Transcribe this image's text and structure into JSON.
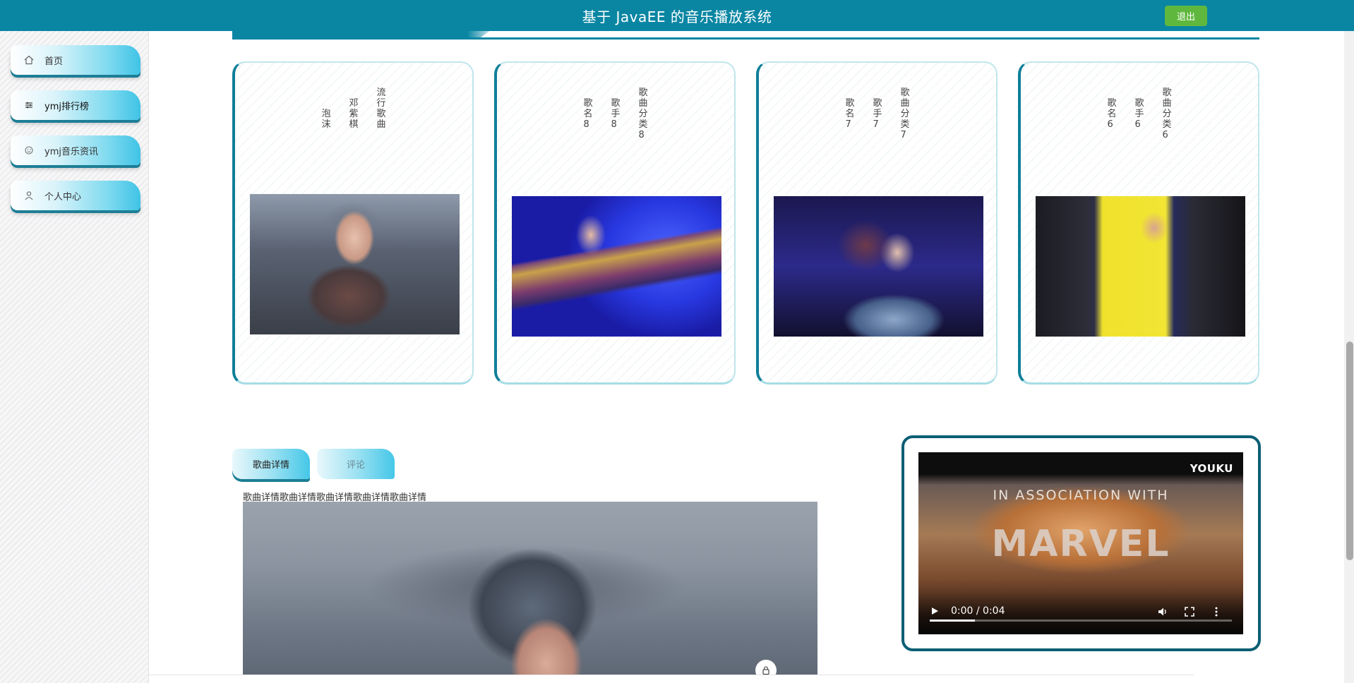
{
  "header": {
    "title": "基于 JavaEE 的音乐播放系统",
    "logout_label": "退出",
    "color": "#0a86a3"
  },
  "sidebar": {
    "items": [
      {
        "label": "首页",
        "icon": "home-icon"
      },
      {
        "label": "ymj排行榜",
        "icon": "sliders-icon"
      },
      {
        "label": "ymj音乐资讯",
        "icon": "news-icon"
      },
      {
        "label": "个人中心",
        "icon": "user-icon"
      }
    ]
  },
  "songs": [
    {
      "name": "泡沫",
      "singer": "邓紫棋",
      "category": "流行歌曲"
    },
    {
      "name": "歌名8",
      "singer": "歌手8",
      "category": "歌曲分类8"
    },
    {
      "name": "歌名7",
      "singer": "歌手7",
      "category": "歌曲分类7"
    },
    {
      "name": "歌名6",
      "singer": "歌手6",
      "category": "歌曲分类6"
    }
  ],
  "tabs": {
    "detail": "歌曲详情",
    "comment": "评论"
  },
  "detail_text": "歌曲详情歌曲详情歌曲详情歌曲详情歌曲详情",
  "video": {
    "brand": "YOUKU",
    "overlay_text": "IN ASSOCIATION WITH",
    "big_text": "MARVEL",
    "time": "0:00 / 0:04",
    "progress": 0.15
  }
}
